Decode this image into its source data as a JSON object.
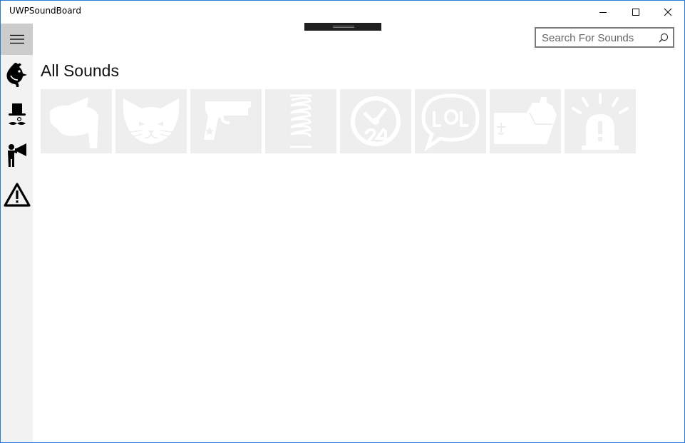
{
  "window": {
    "title": "UWPSoundBoard"
  },
  "nav": {
    "items": [
      {
        "icon": "chicken-icon"
      },
      {
        "icon": "top-hat-mustache-icon"
      },
      {
        "icon": "megaphone-person-icon"
      },
      {
        "icon": "warning-icon"
      }
    ]
  },
  "search": {
    "placeholder": "Search For Sounds",
    "value": ""
  },
  "main": {
    "title": "All Sounds",
    "tiles": [
      {
        "icon": "cow-icon"
      },
      {
        "icon": "cat-icon"
      },
      {
        "icon": "gun-icon"
      },
      {
        "icon": "spring-icon"
      },
      {
        "icon": "clock-24-icon"
      },
      {
        "icon": "lol-bubble-icon"
      },
      {
        "icon": "ship-icon"
      },
      {
        "icon": "siren-icon"
      }
    ]
  },
  "colors": {
    "accent_border": "#2b7bd6",
    "pane_bg": "#f2f2f2",
    "hamburger_bg": "#cccccc",
    "tile_bg": "#eeeeee"
  }
}
